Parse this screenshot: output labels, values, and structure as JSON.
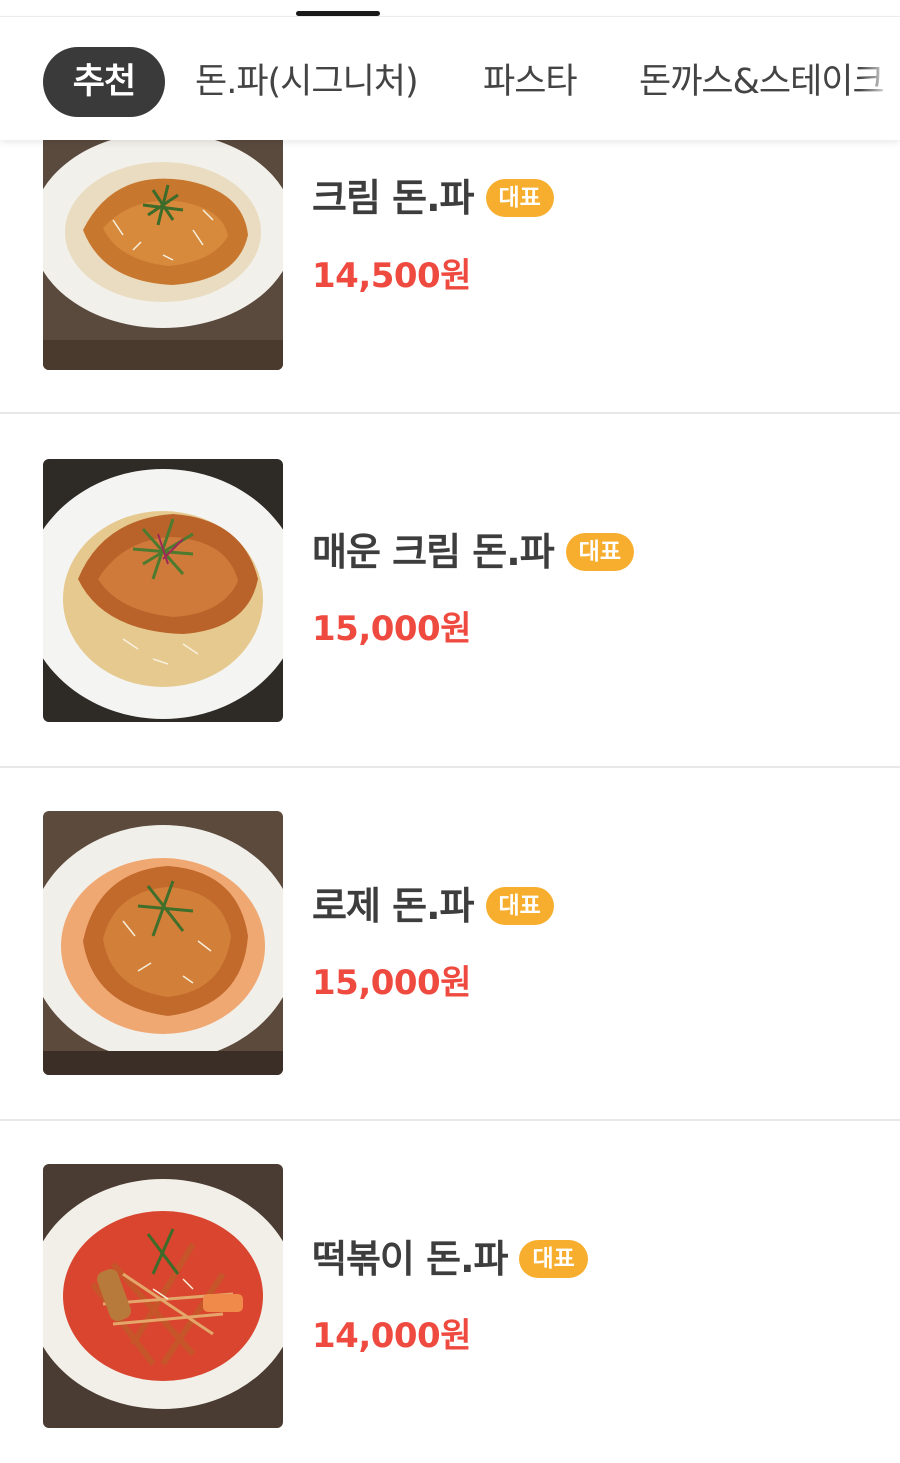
{
  "tabs": [
    {
      "label": "추천",
      "active": true
    },
    {
      "label": "돈.파(시그니처)",
      "active": false
    },
    {
      "label": "파스타",
      "active": false
    },
    {
      "label": "돈까스&스테이크",
      "active": false
    }
  ],
  "menu_items": [
    {
      "name": "크림 돈.파",
      "badge": "대표",
      "price": "14,500원",
      "image": "cream-cutlet-pasta-photo",
      "sauce_color": "#e9dcc0"
    },
    {
      "name": "매운 크림 돈.파",
      "badge": "대표",
      "price": "15,000원",
      "image": "spicy-cream-cutlet-pasta-photo",
      "sauce_color": "#e6c98f"
    },
    {
      "name": "로제 돈.파",
      "badge": "대표",
      "price": "15,000원",
      "image": "rose-cutlet-pasta-photo",
      "sauce_color": "#f0a873"
    },
    {
      "name": "떡볶이 돈.파",
      "badge": "대표",
      "price": "14,000원",
      "image": "tteokbokki-cutlet-pasta-photo",
      "sauce_color": "#d9452e"
    }
  ],
  "colors": {
    "active_tab_bg": "#3a3a3a",
    "badge_bg": "#f7ae2f",
    "price": "#ef4a3f",
    "divider": "#e8e8e8"
  }
}
